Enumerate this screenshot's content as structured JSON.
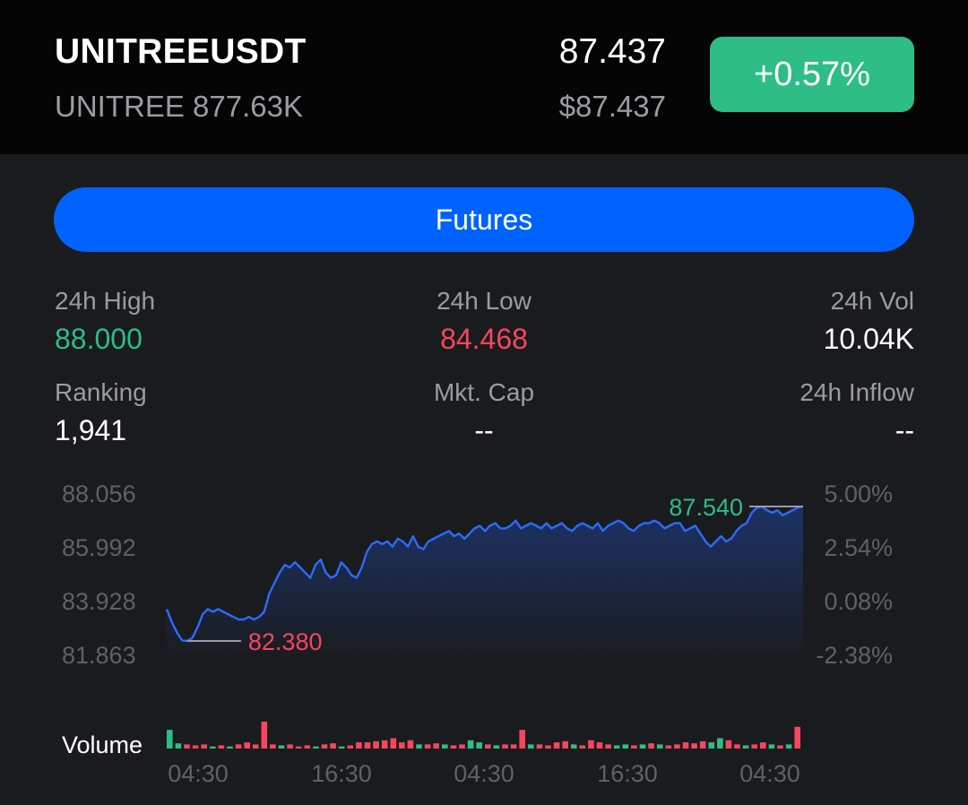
{
  "header": {
    "symbol": "UNITREEUSDT",
    "base_asset": "UNITREE",
    "volume_short": "877.63K",
    "price": "87.437",
    "usd_price": "$87.437",
    "change_pct": "+0.57%"
  },
  "futures_button": {
    "label": "Futures"
  },
  "stats": {
    "high": {
      "label": "24h High",
      "value": "88.000"
    },
    "low": {
      "label": "24h Low",
      "value": "84.468"
    },
    "vol": {
      "label": "24h Vol",
      "value": "10.04K"
    },
    "ranking": {
      "label": "Ranking",
      "value": "1,941"
    },
    "mkt_cap": {
      "label": "Mkt. Cap",
      "value": "--"
    },
    "inflow": {
      "label": "24h Inflow",
      "value": "--"
    }
  },
  "colors": {
    "up": "#2ebd85",
    "down": "#f6465d",
    "accent": "#0062ff",
    "line": "#2c6bff"
  },
  "chart_data": {
    "type": "line",
    "y_ticks": [
      "88.056",
      "85.992",
      "83.928",
      "81.863"
    ],
    "y_tick_values": [
      88.056,
      85.992,
      83.928,
      81.863
    ],
    "pct_ticks": [
      "5.00%",
      "2.54%",
      "0.08%",
      "-2.38%"
    ],
    "x_ticks": [
      "04:30",
      "16:30",
      "04:30",
      "16:30",
      "04:30"
    ],
    "ylim": [
      81.863,
      88.056
    ],
    "max_label": "87.540",
    "min_label": "82.380",
    "max_value": 87.54,
    "min_value": 82.38,
    "volume_label": "Volume",
    "price_series": [
      83.6,
      83.1,
      82.7,
      82.4,
      82.38,
      82.5,
      82.9,
      83.4,
      83.6,
      83.5,
      83.6,
      83.5,
      83.4,
      83.3,
      83.2,
      83.2,
      83.3,
      83.2,
      83.3,
      83.5,
      84.2,
      84.6,
      85.0,
      85.3,
      85.2,
      85.4,
      85.2,
      85.0,
      84.8,
      85.3,
      85.5,
      85.0,
      84.8,
      84.9,
      85.4,
      85.2,
      84.9,
      84.8,
      85.2,
      85.8,
      86.1,
      86.2,
      86.1,
      86.2,
      86.0,
      86.3,
      86.2,
      86.0,
      86.4,
      86.0,
      85.9,
      86.2,
      86.3,
      86.4,
      86.5,
      86.6,
      86.4,
      86.5,
      86.3,
      86.5,
      86.7,
      86.8,
      86.6,
      86.8,
      86.9,
      86.7,
      86.7,
      86.8,
      87.0,
      86.7,
      86.8,
      86.9,
      86.8,
      86.7,
      86.9,
      86.7,
      86.8,
      86.9,
      86.7,
      86.6,
      86.8,
      86.9,
      86.8,
      86.7,
      86.9,
      86.6,
      86.8,
      86.9,
      87.0,
      86.9,
      86.7,
      86.6,
      86.8,
      86.9,
      86.9,
      87.0,
      86.9,
      86.7,
      86.8,
      86.9,
      86.9,
      86.6,
      86.7,
      86.8,
      86.5,
      86.2,
      86.0,
      86.2,
      86.4,
      86.2,
      86.3,
      86.6,
      86.8,
      86.9,
      87.3,
      87.5,
      87.54,
      87.4,
      87.3,
      87.4,
      87.2,
      87.3,
      87.4,
      87.5,
      87.54
    ],
    "volume_series": [
      {
        "v": 0.9,
        "up": true
      },
      {
        "v": 0.25,
        "up": true
      },
      {
        "v": 0.2,
        "up": false
      },
      {
        "v": 0.15,
        "up": false
      },
      {
        "v": 0.2,
        "up": false
      },
      {
        "v": 0.1,
        "up": true
      },
      {
        "v": 0.15,
        "up": false
      },
      {
        "v": 0.1,
        "up": true
      },
      {
        "v": 0.2,
        "up": false
      },
      {
        "v": 0.3,
        "up": false
      },
      {
        "v": 0.2,
        "up": false
      },
      {
        "v": 1.3,
        "up": false
      },
      {
        "v": 0.2,
        "up": false
      },
      {
        "v": 0.15,
        "up": true
      },
      {
        "v": 0.2,
        "up": false
      },
      {
        "v": 0.1,
        "up": false
      },
      {
        "v": 0.15,
        "up": false
      },
      {
        "v": 0.1,
        "up": true
      },
      {
        "v": 0.2,
        "up": false
      },
      {
        "v": 0.25,
        "up": false
      },
      {
        "v": 0.1,
        "up": true
      },
      {
        "v": 0.15,
        "up": false
      },
      {
        "v": 0.3,
        "up": false
      },
      {
        "v": 0.3,
        "up": false
      },
      {
        "v": 0.35,
        "up": false
      },
      {
        "v": 0.4,
        "up": false
      },
      {
        "v": 0.5,
        "up": false
      },
      {
        "v": 0.3,
        "up": false
      },
      {
        "v": 0.4,
        "up": false
      },
      {
        "v": 0.2,
        "up": true
      },
      {
        "v": 0.2,
        "up": false
      },
      {
        "v": 0.25,
        "up": false
      },
      {
        "v": 0.2,
        "up": true
      },
      {
        "v": 0.15,
        "up": false
      },
      {
        "v": 0.2,
        "up": false
      },
      {
        "v": 0.4,
        "up": true
      },
      {
        "v": 0.3,
        "up": true
      },
      {
        "v": 0.2,
        "up": false
      },
      {
        "v": 0.15,
        "up": true
      },
      {
        "v": 0.2,
        "up": false
      },
      {
        "v": 0.2,
        "up": false
      },
      {
        "v": 0.9,
        "up": false
      },
      {
        "v": 0.2,
        "up": true
      },
      {
        "v": 0.2,
        "up": false
      },
      {
        "v": 0.15,
        "up": false
      },
      {
        "v": 0.3,
        "up": false
      },
      {
        "v": 0.35,
        "up": false
      },
      {
        "v": 0.2,
        "up": true
      },
      {
        "v": 0.15,
        "up": false
      },
      {
        "v": 0.4,
        "up": false
      },
      {
        "v": 0.3,
        "up": false
      },
      {
        "v": 0.2,
        "up": false
      },
      {
        "v": 0.15,
        "up": true
      },
      {
        "v": 0.2,
        "up": true
      },
      {
        "v": 0.15,
        "up": false
      },
      {
        "v": 0.2,
        "up": true
      },
      {
        "v": 0.25,
        "up": false
      },
      {
        "v": 0.2,
        "up": true
      },
      {
        "v": 0.15,
        "up": false
      },
      {
        "v": 0.2,
        "up": false
      },
      {
        "v": 0.3,
        "up": false
      },
      {
        "v": 0.25,
        "up": false
      },
      {
        "v": 0.35,
        "up": false
      },
      {
        "v": 0.3,
        "up": true
      },
      {
        "v": 0.5,
        "up": true
      },
      {
        "v": 0.4,
        "up": false
      },
      {
        "v": 0.2,
        "up": false
      },
      {
        "v": 0.15,
        "up": true
      },
      {
        "v": 0.2,
        "up": false
      },
      {
        "v": 0.3,
        "up": false
      },
      {
        "v": 0.2,
        "up": true
      },
      {
        "v": 0.15,
        "up": false
      },
      {
        "v": 0.2,
        "up": true
      },
      {
        "v": 1.05,
        "up": false
      }
    ]
  }
}
